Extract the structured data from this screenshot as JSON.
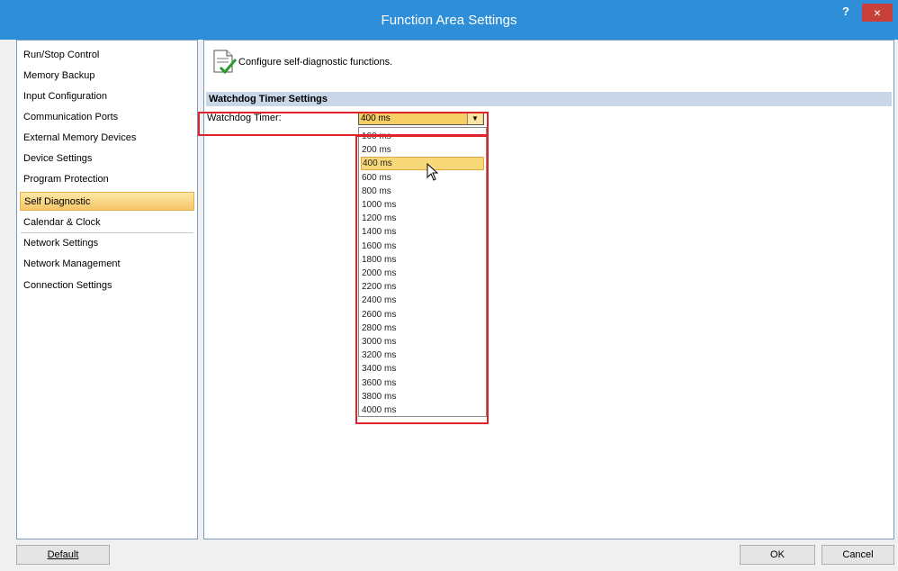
{
  "window": {
    "title": "Function Area Settings",
    "help_label": "?",
    "close_label": "×"
  },
  "sidebar": {
    "items": [
      {
        "label": "Run/Stop Control",
        "selected": false
      },
      {
        "label": "Memory Backup",
        "selected": false
      },
      {
        "label": "Input Configuration",
        "selected": false
      },
      {
        "label": "Communication Ports",
        "selected": false
      },
      {
        "label": "External Memory Devices",
        "selected": false
      },
      {
        "label": "Device Settings",
        "selected": false
      },
      {
        "label": "Program Protection",
        "selected": false
      },
      {
        "label": "Self Diagnostic",
        "selected": true
      },
      {
        "label": "Calendar & Clock",
        "selected": false
      },
      {
        "label": "Network Settings",
        "selected": false
      },
      {
        "label": "Network Management",
        "selected": false
      },
      {
        "label": "Connection Settings",
        "selected": false
      }
    ]
  },
  "main": {
    "description": "Configure self-diagnostic functions.",
    "section_title": "Watchdog Timer Settings",
    "watchdog": {
      "label": "Watchdog Timer:",
      "value": "400 ms",
      "options": [
        "100 ms",
        "200 ms",
        "400 ms",
        "600 ms",
        "800 ms",
        "1000 ms",
        "1200 ms",
        "1400 ms",
        "1600 ms",
        "1800 ms",
        "2000 ms",
        "2200 ms",
        "2400 ms",
        "2600 ms",
        "2800 ms",
        "3000 ms",
        "3200 ms",
        "3400 ms",
        "3600 ms",
        "3800 ms",
        "4000 ms"
      ],
      "highlighted_option": "400 ms"
    }
  },
  "footer": {
    "default_label": "Default",
    "ok_label": "OK",
    "cancel_label": "Cancel"
  },
  "colors": {
    "titlebar": "#2e8fd8",
    "close_button": "#c7403a",
    "selection": "#f6c667",
    "section_header": "#c8d6e8",
    "highlight_annotation": "#e0232b"
  }
}
